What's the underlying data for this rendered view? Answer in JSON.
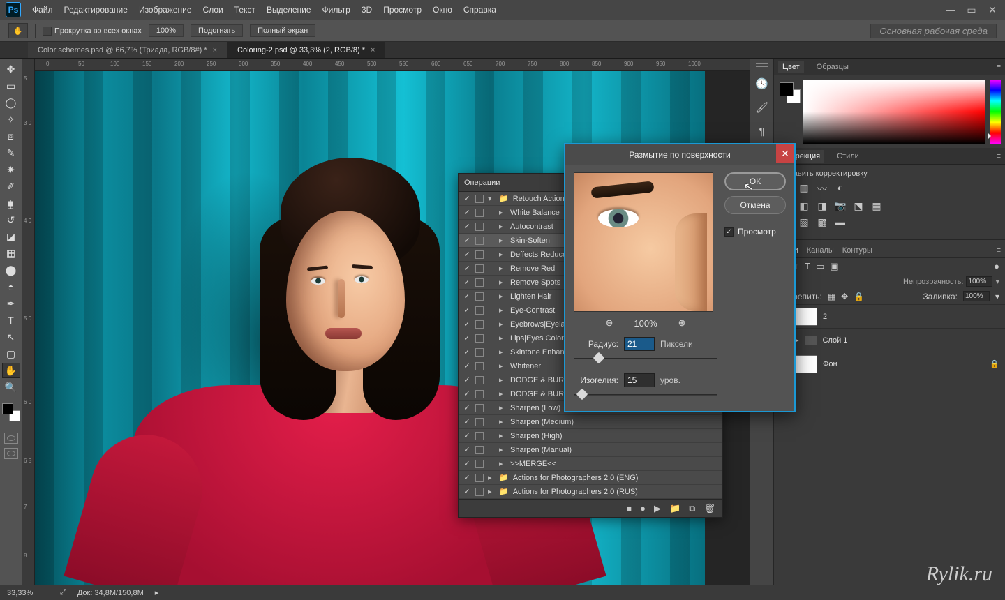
{
  "menu": {
    "items": [
      "Файл",
      "Редактирование",
      "Изображение",
      "Слои",
      "Текст",
      "Выделение",
      "Фильтр",
      "3D",
      "Просмотр",
      "Окно",
      "Справка"
    ]
  },
  "options": {
    "scroll_all": "Прокрутка во всех окнах",
    "zoom_value": "100%",
    "fit": "Подогнать",
    "fullscreen": "Полный экран",
    "workspace": "Основная рабочая среда"
  },
  "tabs": [
    {
      "label": "Color schemes.psd @ 66,7% (Триада, RGB/8#) *",
      "active": false
    },
    {
      "label": "Coloring-2.psd @ 33,3% (2, RGB/8) *",
      "active": true
    }
  ],
  "ruler_h": [
    "0",
    "50",
    "100",
    "150",
    "200",
    "250",
    "300",
    "350",
    "400",
    "450",
    "500",
    "550",
    "600",
    "650",
    "700",
    "750",
    "800",
    "850",
    "900",
    "950",
    "1000"
  ],
  "ruler_v": [
    "5",
    "3 0",
    "4 0",
    "5 0",
    "6 0",
    "6 5",
    "7",
    "8"
  ],
  "color_tabs": {
    "color": "Цвет",
    "swatches": "Образцы"
  },
  "adjust_tabs": {
    "corr": "Коррекция",
    "styles": "Стили"
  },
  "adjust_title": "Добавить корректировку",
  "layers_tabs": {
    "layers": "Слои",
    "channels": "Каналы",
    "paths": "Контуры"
  },
  "layers": {
    "opacity_label": "Непрозрачность:",
    "opacity_value": "100%",
    "fill_label": "Заливка:",
    "fill_value": "100%",
    "lock_label": "Закрепить:",
    "items": [
      {
        "name": "2",
        "kind": "layer"
      },
      {
        "name": "Слой 1",
        "kind": "group"
      },
      {
        "name": "Фон",
        "kind": "bg"
      }
    ]
  },
  "actions": {
    "title": "Операции",
    "sets": [
      {
        "name": "Retouch Actions",
        "open": true,
        "folder": true
      },
      {
        "name": "White Balance"
      },
      {
        "name": "Autocontrast"
      },
      {
        "name": "Skin-Soften",
        "selected": true
      },
      {
        "name": "Deffects Reduce"
      },
      {
        "name": "Remove Red"
      },
      {
        "name": "Remove Spots"
      },
      {
        "name": "Lighten Hair"
      },
      {
        "name": "Eye-Contrast"
      },
      {
        "name": "Eyebrows|Eyelashes"
      },
      {
        "name": "Lips|Eyes Coloring"
      },
      {
        "name": "Skintone Enhance"
      },
      {
        "name": "Whitener"
      },
      {
        "name": "DODGE & BURN 1"
      },
      {
        "name": "DODGE & BURN 2"
      },
      {
        "name": "Sharpen (Low)"
      },
      {
        "name": "Sharpen (Medium)"
      },
      {
        "name": "Sharpen (High)"
      },
      {
        "name": "Sharpen (Manual)"
      },
      {
        "name": ">>MERGE<<"
      },
      {
        "name": "Actions for Photographers 2.0 (ENG)",
        "folder": true
      },
      {
        "name": "Actions for Photographers 2.0 (RUS)",
        "folder": true
      }
    ]
  },
  "dialog": {
    "title": "Размытие по поверхности",
    "ok": "ОК",
    "cancel": "Отмена",
    "preview": "Просмотр",
    "zoom": "100%",
    "radius_label": "Радиус:",
    "radius_value": "21",
    "radius_unit": "Пиксели",
    "threshold_label": "Изогелия:",
    "threshold_value": "15",
    "threshold_unit": "уров."
  },
  "status": {
    "zoom": "33,33%",
    "doc": "Док: 34,8M/150,8M"
  },
  "watermark": "Rylik.ru"
}
